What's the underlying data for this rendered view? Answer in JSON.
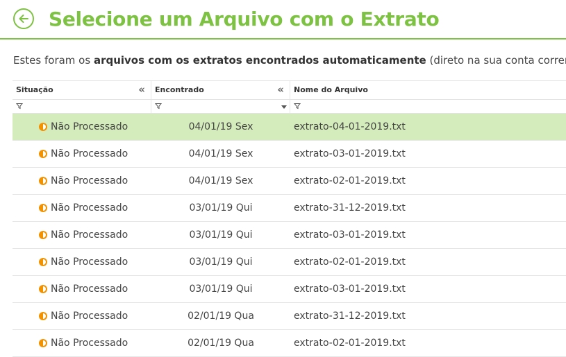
{
  "header": {
    "title": "Selecione um Arquivo com o Extrato",
    "accent_color": "#7dc242",
    "back_icon": "arrow-left-circle-icon"
  },
  "subtitle": {
    "prefix": "Estes foram os ",
    "bold": "arquivos com os extratos encontrados automaticamente",
    "suffix": " (direto na sua conta corrente)"
  },
  "table": {
    "columns": [
      "Situação",
      "Encontrado",
      "Nome do Arquivo"
    ],
    "status_color": "#f39200",
    "selected_row_color": "#d4ecbb",
    "rows": [
      {
        "status": "Não Processado",
        "found": "04/01/19 Sex",
        "file": "extrato-04-01-2019.txt",
        "selected": true
      },
      {
        "status": "Não Processado",
        "found": "04/01/19 Sex",
        "file": "extrato-03-01-2019.txt",
        "selected": false
      },
      {
        "status": "Não Processado",
        "found": "04/01/19 Sex",
        "file": "extrato-02-01-2019.txt",
        "selected": false
      },
      {
        "status": "Não Processado",
        "found": "03/01/19 Qui",
        "file": "extrato-31-12-2019.txt",
        "selected": false
      },
      {
        "status": "Não Processado",
        "found": "03/01/19 Qui",
        "file": "extrato-03-01-2019.txt",
        "selected": false
      },
      {
        "status": "Não Processado",
        "found": "03/01/19 Qui",
        "file": "extrato-02-01-2019.txt",
        "selected": false
      },
      {
        "status": "Não Processado",
        "found": "03/01/19 Qui",
        "file": "extrato-03-01-2019.txt",
        "selected": false
      },
      {
        "status": "Não Processado",
        "found": "02/01/19 Qua",
        "file": "extrato-31-12-2019.txt",
        "selected": false
      },
      {
        "status": "Não Processado",
        "found": "02/01/19 Qua",
        "file": "extrato-02-01-2019.txt",
        "selected": false
      }
    ]
  }
}
